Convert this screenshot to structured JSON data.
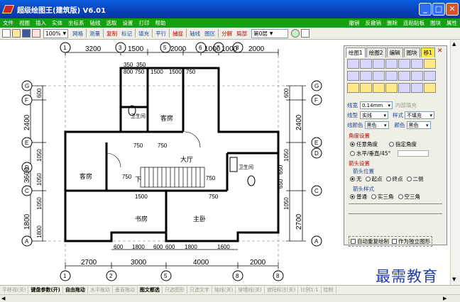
{
  "window": {
    "title": "超级绘图王(建筑版) V6.01",
    "min_label": "_",
    "max_label": "□",
    "close_label": "✕"
  },
  "menubar": {
    "left": [
      "文件",
      "视图",
      "插入",
      "实体",
      "坐标系",
      "轴线",
      "选取",
      "设置",
      "打印",
      "帮助"
    ],
    "right": [
      "撤销",
      "反撤销",
      "删除",
      "连粘贴板",
      "图块",
      "属性"
    ]
  },
  "toolbar": {
    "zoom": "100%",
    "items": [
      "网格",
      "测量",
      "复制",
      "标记",
      "填充",
      "平行",
      "捕捉",
      "轴线",
      "图区",
      "分解",
      "局部"
    ],
    "layer": "第0层"
  },
  "drawing": {
    "top_dims": [
      "3200",
      "1500",
      "2000",
      "1000",
      "1000",
      "2000"
    ],
    "top_small_dims": [
      "350",
      "350",
      "800",
      "750",
      "1500",
      "1500",
      "750"
    ],
    "bottom_dims": [
      "2700",
      "3000",
      "4000",
      "2000"
    ],
    "bottom_small_dims": [
      "600",
      "1800",
      "600",
      "600",
      "1800",
      "1600"
    ],
    "left_dims": [
      "600",
      "2400",
      "1050",
      "1050",
      "3600",
      "1050",
      "1800",
      "1800"
    ],
    "right_dims": [
      "600",
      "2400",
      "1050",
      "650",
      "650",
      "1050",
      "2700"
    ],
    "inner_dims": [
      "750",
      "750",
      "750",
      "750",
      "1500",
      "750"
    ],
    "axis_top": [
      "1",
      "3",
      "5",
      "6",
      "7",
      "8"
    ],
    "axis_bottom": [
      "1",
      "2",
      "5",
      "8",
      "8"
    ],
    "axis_left": [
      "G",
      "F",
      "E",
      "D",
      "C",
      "A"
    ],
    "axis_right": [
      "G",
      "F",
      "E",
      "D",
      "C",
      "A"
    ],
    "rooms": {
      "guest_top": "客房",
      "bath_top": "卫生间",
      "living": "大厅",
      "guest_left": "客房",
      "bath_right": "卫生间",
      "down": "下",
      "study": "书房",
      "master": "主卧"
    }
  },
  "panel": {
    "tabs": [
      "绘图1",
      "绘图2",
      "编辑",
      "图块"
    ],
    "tab_active": "移1",
    "close": "✕",
    "line_width_label": "线宽",
    "line_width_value": "0.14mm",
    "inner_fill_label": "内部填充",
    "line_type_label": "线型",
    "line_type_value": "实线",
    "style_label": "样式",
    "style_value": "不填充",
    "line_color_label": "线颜色",
    "line_color_value": "黑色",
    "color_label": "颜色",
    "color_value": "黑色",
    "angle_section": "角度设置",
    "angle_opts": [
      "任意角度",
      "指定角度",
      "水平/垂直/45°"
    ],
    "arrow_section": "箭头设置",
    "arrow_pos_label": "箭头位置",
    "arrow_pos_opts": [
      "无",
      "起点",
      "终点",
      "二侧"
    ],
    "arrow_style_label": "箭头样式",
    "arrow_style_opts": [
      "普通",
      "实三角",
      "空三角"
    ],
    "auto_repeat": "自动重复绘制",
    "as_independent": "作为独立图形"
  },
  "statusbar": {
    "items": [
      "平移视(关)",
      "键盘参数(开)",
      "自由拖动",
      "水平拖动",
      "垂直拖动",
      "图文都选",
      "只选图形",
      "只选文字",
      "轴线(关)",
      "穿墙线(关)",
      "遮阳标注(关)",
      "比例1:1",
      "绘制"
    ]
  },
  "watermark": "最需教育"
}
